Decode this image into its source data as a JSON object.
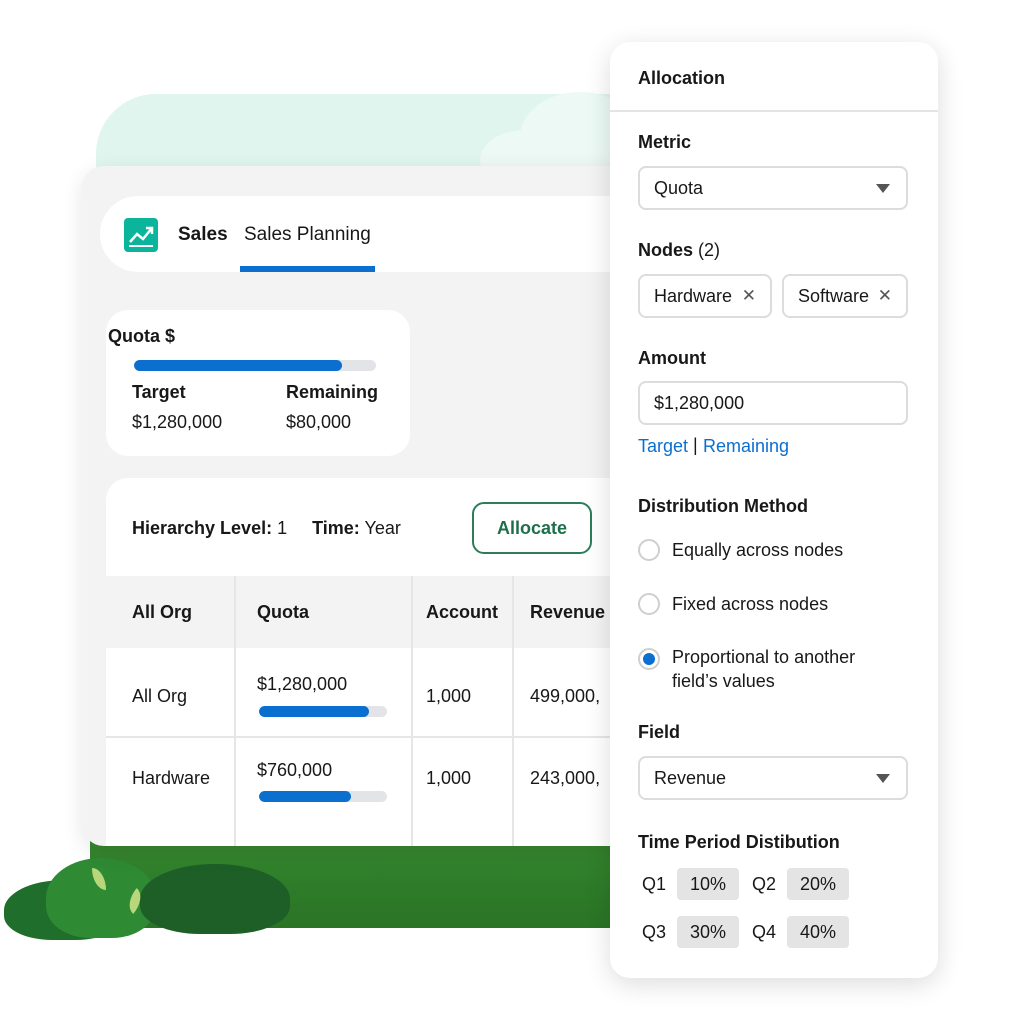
{
  "header": {
    "app_icon": "sales-chart-icon",
    "app_name": "Sales",
    "active_tab": "Sales Planning"
  },
  "quota_summary": {
    "title": "Quota $",
    "progress": 0.86,
    "target_label": "Target",
    "target_value": "$1,280,000",
    "remaining_label": "Remaining",
    "remaining_value": "$80,000"
  },
  "filters": {
    "hierarchy_label": "Hierarchy Level:",
    "hierarchy_value": "1",
    "time_label": "Time:",
    "time_value": "Year",
    "allocate_label": "Allocate"
  },
  "table": {
    "columns": [
      "All Org",
      "Quota",
      "Account",
      "Revenue"
    ],
    "rows": [
      {
        "name": "All Org",
        "quota": "$1,280,000",
        "quota_progress": 0.86,
        "account": "1,000",
        "revenue": "499,000,"
      },
      {
        "name": "Hardware",
        "quota": "$760,000",
        "quota_progress": 0.72,
        "account": "1,000",
        "revenue": "243,000,"
      }
    ]
  },
  "allocation": {
    "title": "Allocation",
    "metric_label": "Metric",
    "metric_value": "Quota",
    "nodes_label": "Nodes",
    "nodes_count": "(2)",
    "nodes": [
      "Hardware",
      "Software"
    ],
    "amount_label": "Amount",
    "amount_value": "$1,280,000",
    "link_target": "Target",
    "link_separator": "|",
    "link_remaining": "Remaining",
    "distribution_label": "Distribution Method",
    "methods": [
      {
        "label": "Equally across nodes",
        "selected": false
      },
      {
        "label": "Fixed across nodes",
        "selected": false
      },
      {
        "label": "Proportional to another field’s values",
        "selected": true
      }
    ],
    "field_label": "Field",
    "field_value": "Revenue",
    "time_period_label": "Time Period Distibution",
    "periods": [
      {
        "q": "Q1",
        "pct": "10%"
      },
      {
        "q": "Q2",
        "pct": "20%"
      },
      {
        "q": "Q3",
        "pct": "30%"
      },
      {
        "q": "Q4",
        "pct": "40%"
      }
    ]
  },
  "colors": {
    "accent": "#0b6fd0",
    "allocate_border": "#2e7d5a",
    "app_icon": "#0bb59c",
    "grass": "#2e7d2a"
  }
}
